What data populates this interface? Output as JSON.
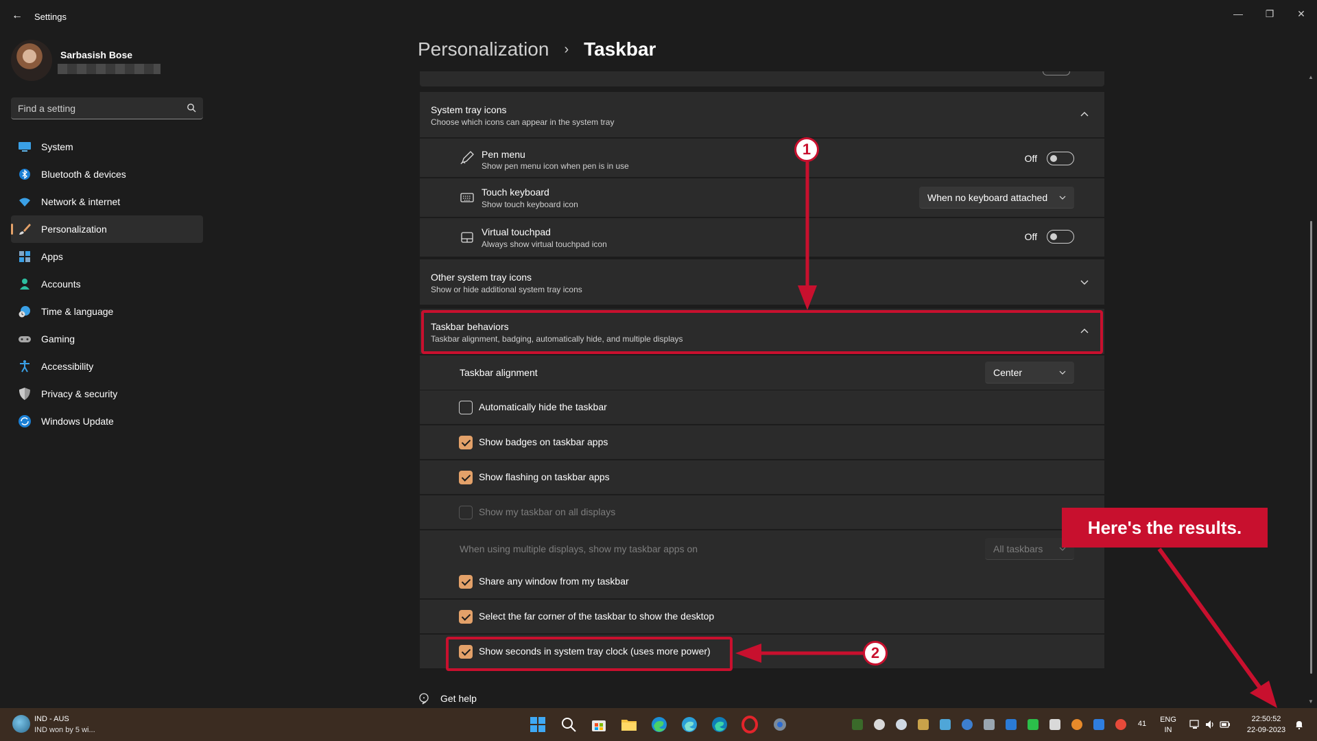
{
  "window": {
    "title": "Settings",
    "back_glyph": "←",
    "minimize_glyph": "—",
    "restore_glyph": "❐",
    "close_glyph": "✕"
  },
  "profile": {
    "name": "Sarbasish Bose"
  },
  "search": {
    "placeholder": "Find a setting"
  },
  "sidebar": {
    "items": [
      {
        "label": "System",
        "icon": "monitor-icon"
      },
      {
        "label": "Bluetooth & devices",
        "icon": "bluetooth-icon"
      },
      {
        "label": "Network & internet",
        "icon": "wifi-icon"
      },
      {
        "label": "Personalization",
        "icon": "brush-icon",
        "active": true
      },
      {
        "label": "Apps",
        "icon": "apps-icon"
      },
      {
        "label": "Accounts",
        "icon": "person-icon"
      },
      {
        "label": "Time & language",
        "icon": "clock-globe-icon"
      },
      {
        "label": "Gaming",
        "icon": "gamepad-icon"
      },
      {
        "label": "Accessibility",
        "icon": "accessibility-icon"
      },
      {
        "label": "Privacy & security",
        "icon": "shield-icon"
      },
      {
        "label": "Windows Update",
        "icon": "update-icon"
      }
    ]
  },
  "header": {
    "parent": "Personalization",
    "separator": "›",
    "current": "Taskbar"
  },
  "system_tray": {
    "title": "System tray icons",
    "subtitle": "Choose which icons can appear in the system tray",
    "items": [
      {
        "title": "Pen menu",
        "subtitle": "Show pen menu icon when pen is in use",
        "state": "Off"
      },
      {
        "title": "Touch keyboard",
        "subtitle": "Show touch keyboard icon",
        "value": "When no keyboard attached"
      },
      {
        "title": "Virtual touchpad",
        "subtitle": "Always show virtual touchpad icon",
        "state": "Off"
      }
    ]
  },
  "other_tray": {
    "title": "Other system tray icons",
    "subtitle": "Show or hide additional system tray icons"
  },
  "behaviors": {
    "title": "Taskbar behaviors",
    "subtitle": "Taskbar alignment, badging, automatically hide, and multiple displays",
    "alignment_label": "Taskbar alignment",
    "alignment_value": "Center",
    "checkboxes": [
      {
        "label": "Automatically hide the taskbar",
        "checked": false
      },
      {
        "label": "Show badges on taskbar apps",
        "checked": true
      },
      {
        "label": "Show flashing on taskbar apps",
        "checked": true
      },
      {
        "label": "Show my taskbar on all displays",
        "checked": false,
        "disabled": true
      }
    ],
    "multi_display_label": "When using multiple displays, show my taskbar apps on",
    "multi_display_value": "All taskbars",
    "checkboxes2": [
      {
        "label": "Share any window from my taskbar",
        "checked": true
      },
      {
        "label": "Select the far corner of the taskbar to show the desktop",
        "checked": true
      },
      {
        "label": "Show seconds in system tray clock (uses more power)",
        "checked": true
      }
    ]
  },
  "help": {
    "label": "Get help"
  },
  "annotations": {
    "step1": "1",
    "step2": "2",
    "banner": "Here's the results.",
    "color": "#c8102e"
  },
  "taskbar": {
    "news_title": "IND - AUS",
    "news_sub": "IND won by 5 wi...",
    "lang_top": "ENG",
    "lang_bottom": "IN",
    "badge_count": "41",
    "time": "22:50:52",
    "date": "22-09-2023"
  },
  "colors": {
    "accent": "#e3a169",
    "background": "#1c1c1c",
    "card": "#2b2b2b"
  }
}
